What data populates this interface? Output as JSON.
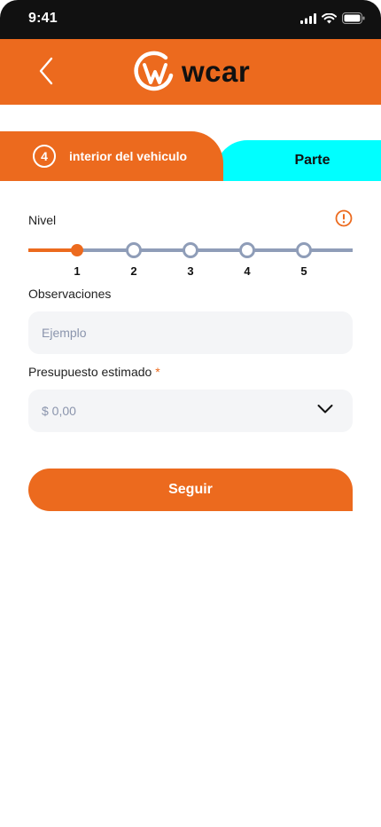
{
  "status_bar": {
    "time": "9:41"
  },
  "header": {
    "logo_text": "wcar"
  },
  "tabs": {
    "active": {
      "step": "4",
      "label": "interior del vehiculo"
    },
    "next": {
      "label": "Parte"
    }
  },
  "form": {
    "level": {
      "label": "Nivel",
      "ticks": [
        "1",
        "2",
        "3",
        "4",
        "5"
      ],
      "selected": 1
    },
    "observations": {
      "label": "Observaciones",
      "placeholder": "Ejemplo"
    },
    "budget": {
      "label": "Presupuesto estimado",
      "required_mark": "*",
      "placeholder": "$ 0,00"
    },
    "submit_label": "Seguir"
  },
  "colors": {
    "brand": "#ec6a1e",
    "accent_tab": "#00ffff",
    "track": "#8f9db8"
  }
}
